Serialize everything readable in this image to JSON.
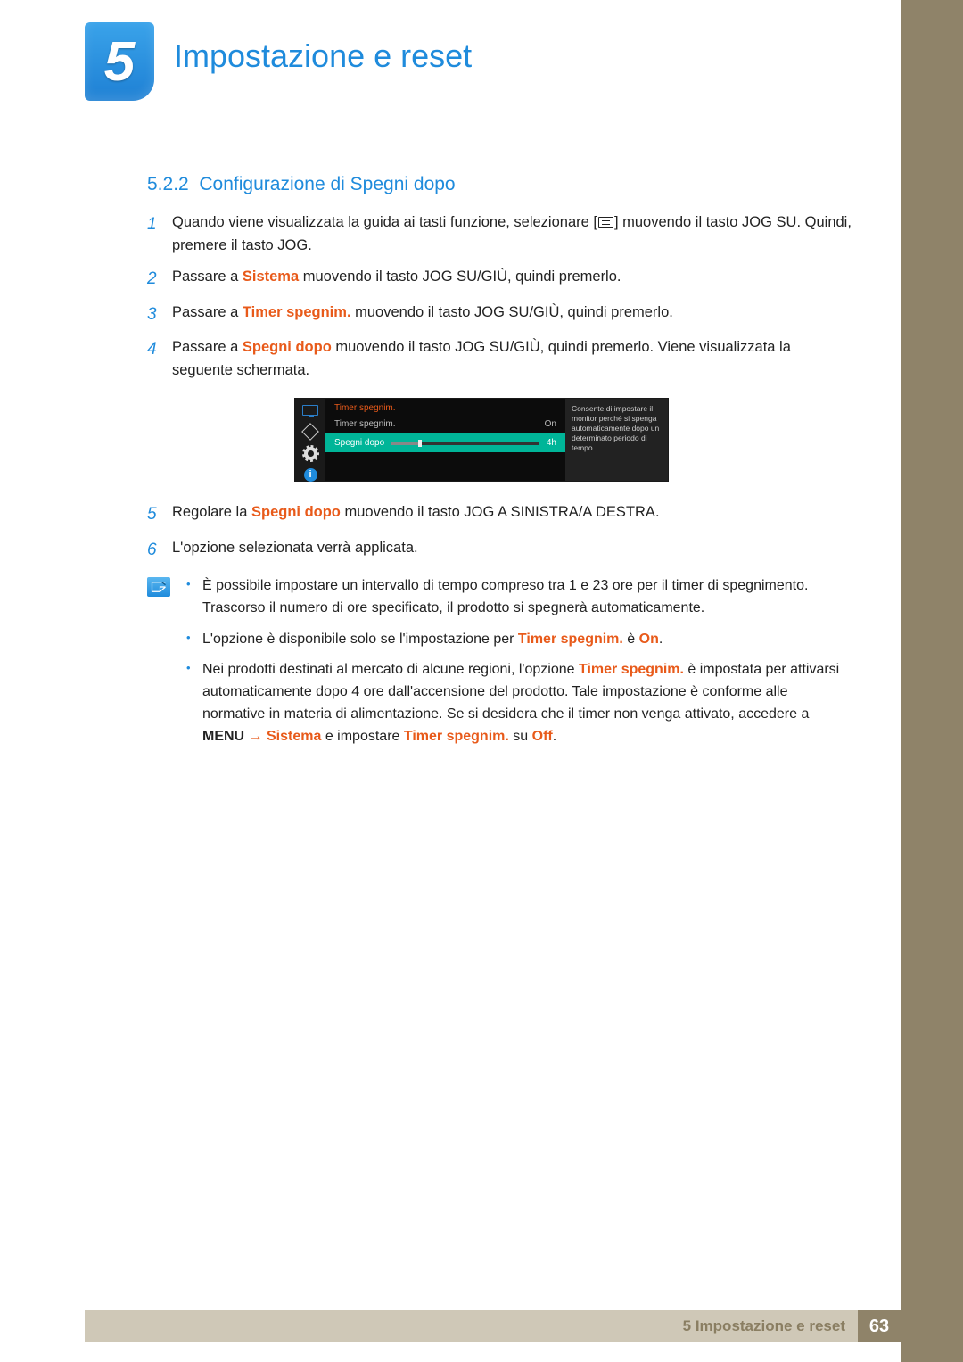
{
  "chapter": {
    "number": "5",
    "title": "Impostazione e reset"
  },
  "section": {
    "number": "5.2.2",
    "title": "Configurazione di Spegni dopo"
  },
  "steps": {
    "s1": "Quando viene visualizzata la guida ai tasti funzione, selezionare [",
    "s1b": "] muovendo il tasto JOG SU. Quindi, premere il tasto JOG.",
    "s2a": "Passare a ",
    "s2hl": "Sistema",
    "s2b": " muovendo il tasto JOG SU/GIÙ, quindi premerlo.",
    "s3a": "Passare a ",
    "s3hl": "Timer spegnim.",
    "s3b": " muovendo il tasto JOG SU/GIÙ, quindi premerlo.",
    "s4a": "Passare a ",
    "s4hl": "Spegni dopo",
    "s4b": " muovendo il tasto JOG SU/GIÙ, quindi premerlo. Viene visualizzata la seguente schermata.",
    "s5a": "Regolare la ",
    "s5hl": "Spegni dopo",
    "s5b": " muovendo il tasto JOG A SINISTRA/A DESTRA.",
    "s6": "L'opzione selezionata verrà applicata."
  },
  "osd": {
    "header": "Timer spegnim.",
    "row1_label": "Timer spegnim.",
    "row1_value": "On",
    "row2_label": "Spegni dopo",
    "row2_value": "4h",
    "desc": "Consente di impostare il monitor perché si spenga automaticamente dopo un determinato periodo di tempo."
  },
  "notes": {
    "n1": "È possibile impostare un intervallo di tempo compreso tra 1 e 23 ore per il timer di spegnimento. Trascorso il numero di ore specificato, il prodotto si spegnerà automaticamente.",
    "n2a": "L'opzione è disponibile solo se l'impostazione per ",
    "n2hl1": "Timer spegnim.",
    "n2mid": " è ",
    "n2hl2": "On",
    "n2end": ".",
    "n3a": "Nei prodotti destinati al mercato di alcune regioni, l'opzione ",
    "n3hl1": "Timer spegnim.",
    "n3b": " è impostata per attivarsi automaticamente dopo 4 ore dall'accensione del prodotto. Tale impostazione è conforme alle normative in materia di alimentazione. Se si desidera che il timer non venga attivato, accedere a ",
    "n3menu": "MENU",
    "n3arrow": " → ",
    "n3hl2": "Sistema",
    "n3c": " e impostare ",
    "n3hl3": "Timer spegnim.",
    "n3d": " su ",
    "n3hl4": "Off",
    "n3end": "."
  },
  "footer": {
    "label": "5 Impostazione e reset",
    "page": "63"
  }
}
